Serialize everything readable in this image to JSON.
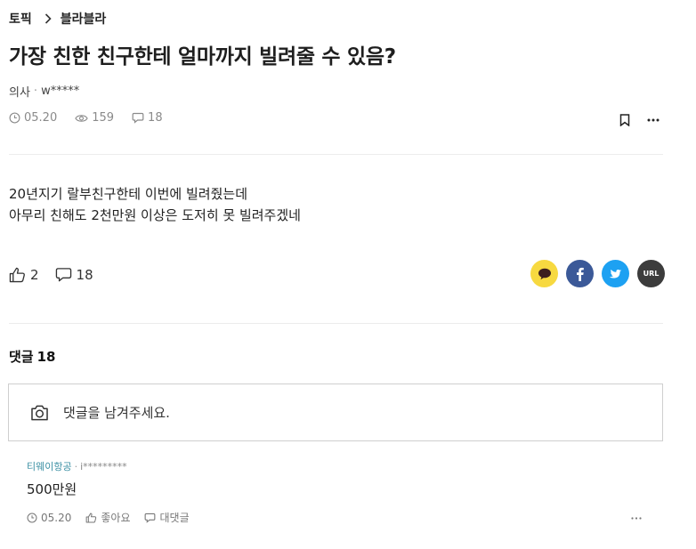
{
  "breadcrumb": {
    "root": "토픽",
    "current": "블라블라"
  },
  "post": {
    "title": "가장 친한 친구한테 얼마까지 빌려줄 수 있음?",
    "author_company": "의사",
    "author_sep": "·",
    "author_id": "w*****",
    "date": "05.20",
    "views": "159",
    "comments": "18",
    "body_lines": [
      "20년지기 랄부친구한테 이번에 빌려줬는데",
      "아무리 친해도 2천만원 이상은 도저히 못 빌려주겠네"
    ],
    "likes": "2",
    "comment_count": "18"
  },
  "share": {
    "url_label": "URL"
  },
  "comments_section": {
    "label": "댓글",
    "count": "18",
    "placeholder": "댓글을 남겨주세요."
  },
  "comment": {
    "author_company": "티웨이항공",
    "author_sep": "·",
    "author_id": "i*********",
    "text": "500만원",
    "date": "05.20",
    "like_label": "좋아요",
    "reply_label": "대댓글"
  },
  "colors": {
    "kakao": "#f7d940",
    "facebook": "#3b5998",
    "twitter": "#1da1f2",
    "url": "#3c3c3c",
    "comment_author": "#3a8fa3"
  }
}
